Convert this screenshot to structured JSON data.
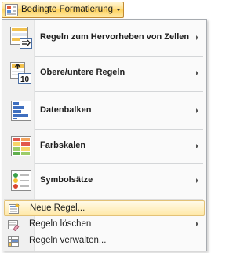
{
  "ribbon": {
    "label": "Bedingte Formatierung",
    "icon": "conditional-formatting-icon"
  },
  "menu": {
    "items": [
      {
        "label": "Regeln zum Hervorheben von Zellen",
        "icon": "highlight-cells-rules-icon",
        "submenu": true
      },
      {
        "label": "Obere/untere Regeln",
        "icon": "top-bottom-rules-icon",
        "submenu": true
      },
      {
        "label": "Datenbalken",
        "icon": "data-bars-icon",
        "submenu": true
      },
      {
        "label": "Farbskalen",
        "icon": "color-scales-icon",
        "submenu": true
      },
      {
        "label": "Symbolsätze",
        "icon": "icon-sets-icon",
        "submenu": true
      }
    ],
    "commands": [
      {
        "label": "Neue Regel...",
        "icon": "new-rule-icon",
        "highlighted": true
      },
      {
        "label": "Regeln löschen",
        "icon": "clear-rules-icon",
        "submenu": true
      },
      {
        "label": "Regeln verwalten...",
        "icon": "manage-rules-icon"
      }
    ]
  }
}
